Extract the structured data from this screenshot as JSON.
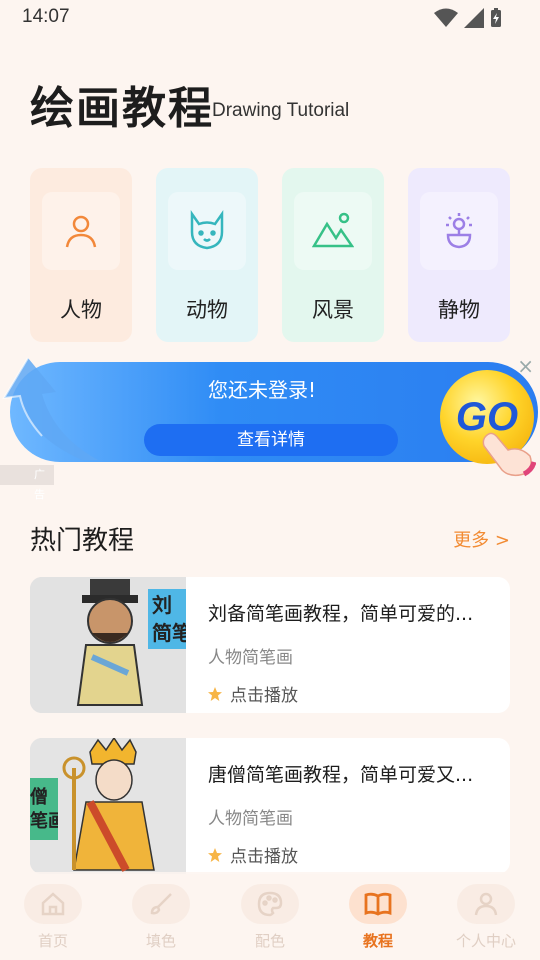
{
  "status_bar": {
    "time": "14:07"
  },
  "header": {
    "title": "绘画教程",
    "subtitle": "Drawing Tutorial"
  },
  "categories": [
    {
      "label": "人物",
      "icon": "person-icon",
      "bg": "#fdebdf",
      "color": "#f2883a"
    },
    {
      "label": "动物",
      "icon": "cat-icon",
      "bg": "#e3f5f7",
      "color": "#35b6bd"
    },
    {
      "label": "风景",
      "icon": "mountain-icon",
      "bg": "#e3f7ee",
      "color": "#36c187"
    },
    {
      "label": "静物",
      "icon": "lamp-icon",
      "bg": "#eeeafd",
      "color": "#9c7fe6"
    }
  ],
  "ad": {
    "title": "您还未登录!",
    "button": "查看详情",
    "go": "GO",
    "tag": "广告",
    "close": "×"
  },
  "section": {
    "title": "热门教程",
    "more": "更多 >"
  },
  "tutorials": [
    {
      "title": "刘备简笔画教程，简单可爱的...",
      "category": "人物简笔画",
      "play": "点击播放",
      "thumb_text": "刘\n简笔"
    },
    {
      "title": "唐僧简笔画教程，简单可爱又...",
      "category": "人物简笔画",
      "play": "点击播放",
      "thumb_text": "僧\n笔画"
    }
  ],
  "nav": [
    {
      "label": "首页",
      "icon": "home-icon"
    },
    {
      "label": "填色",
      "icon": "brush-icon"
    },
    {
      "label": "配色",
      "icon": "palette-icon"
    },
    {
      "label": "教程",
      "icon": "book-icon",
      "active": true
    },
    {
      "label": "个人中心",
      "icon": "user-icon"
    }
  ],
  "colors": {
    "accent": "#e8731f",
    "more": "#f28b33",
    "star": "#f7b545",
    "ad_blue": "#2b7df0"
  }
}
